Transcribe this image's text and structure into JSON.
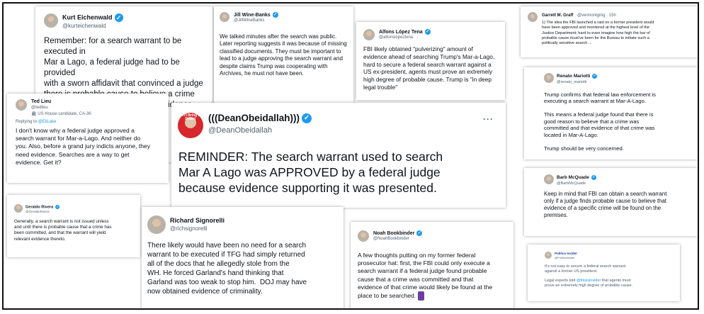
{
  "tweets": {
    "eichenwald": {
      "name": "Kurt Eichenwald",
      "handle": "@kurteichenwald",
      "text": "Remember: for a search warrant to be executed in\nMar a Lago, a federal judge had to be provided\nwith a sworn affidavit that convinced a judge\nthere is probable cause to believe a crime\noccurred and that there may be evidence there\nthat could prove the allegation."
    },
    "winebanks": {
      "name": "Jill Wine-Banks",
      "handle": "@JillWineBanks",
      "text": "We talked minutes after the search was public.\nLater reporting suggests it was because of missing\nclassified documents. They must be important to\nlead to a judge approving the search warrant and\ndespite claims Trump was cooperating with\nArchives, he must not have been."
    },
    "tena": {
      "name": "Alfons López Tena",
      "handle": "@alfonslopeztena",
      "text": "FBI likely obtained \"pulverizing\" amount of\nevidence ahead of searching Trump's Mar-a-Lago,\nhard to secure a federal search warrant against a\nUS ex-president, agents must prove an extremely\nhigh degree of probable cause. Trump is \"in deep\nlegal trouble\""
    },
    "graff": {
      "name": "Garrett M. Graff",
      "handle": "@vermontgmg",
      "time": "· 15h",
      "text": "1) The idea the FBI launched a raid on a former president would\nhave been approved and monitored at the highest level of the\nJustice Department; hard to even imagine how high the bar of\nprobable cause must've been for the Bureau to initiate such a\npolitically sensitive search ..."
    },
    "lieu": {
      "name": "Ted Lieu",
      "handle": "@tedlieu",
      "label": "US House candidate, CA-36",
      "reply_prefix": "Replying to ",
      "reply_to": "@EliLake",
      "text": "I don't know why a federal judge approved a\nsearch warrant for Mar-a-Lago. And neither do\nyou. Also, before a grand jury indicts anyone, they\nneed evidence. Searches are a way to get\nevidence. Get it?"
    },
    "obeidallah": {
      "name": "(((DeanObeidallah)))",
      "handle": "@DeanObeidallah",
      "avatar_text": "Don't Bring Me Down!",
      "text": "REMINDER: The search warrant used to search\nMar A Lago was APPROVED by a federal judge\nbecause evidence supporting it was presented."
    },
    "mariotti": {
      "name": "Renato Mariotti",
      "handle": "@renato_mariotti",
      "text": "Trump confirms that federal law enforcement is\nexecuting a search warrant at Mar-A-Lago.\n\nThis means a federal judge found that there is\ngood reason to believe that a crime was\ncommitted and that evidence of that crime was\nlocated in Mar-A-Lago.\n\nTrump should be very concerned."
    },
    "mcquade": {
      "name": "Barb McQuade",
      "handle": "@BarbMcQuade",
      "text": "Keep in mind that FBI can obtain a search warrant\nonly if a judge finds probable cause to believe that\nevidence of a specific crime will be found on the\npremises."
    },
    "rivera": {
      "name": "Geraldo Rivera",
      "handle": "@GeraldoRivera",
      "text": "Generally, a search warrant is not issued unless\nand until there is probable cause that a crime has\nbeen committed, and that the warrant will yield\nrelevant evidence thereto."
    },
    "signorelli": {
      "name": "Richard Signorelli",
      "handle": "@richsignorelli",
      "text": "There likely would have been no need for a search\nwarrant to be executed if TFG had simply returned\nall of the docs that he allegedly stole from the\nWH. He forced Garland's hand thinking that\nGarland was too weak to stop him.  DOJ may have\nnow obtained evidence of criminality."
    },
    "bookbinder": {
      "name": "Noah Bookbinder",
      "handle": "@NoahBookbinder",
      "text": "A few thoughts putting on my former federal\nprosecutor hat: first, the FBI could only execute a\nsearch warrant if a federal judge found probable\ncause that a crime was committed and that\nevidence of that crime would likely be found at the\nplace to be searched."
    },
    "politico": {
      "name": "Politics Insider",
      "handle": "@PoliticsInsider",
      "text": "It's not easy to secure a federal search warrant\nagainst a former US president.",
      "text2_prefix": "Legal experts told ",
      "text2_link": "@thisisinsider",
      "text2_suffix": " that agents must\nprove an extremely high degree of probable cause."
    }
  },
  "ui": {
    "more_icon": "···",
    "verified_icon": "✓"
  },
  "colors": {
    "verified": "#1d9bf0",
    "link": "#1d9bf0",
    "scroll_emoji": "#6b3fa0"
  }
}
